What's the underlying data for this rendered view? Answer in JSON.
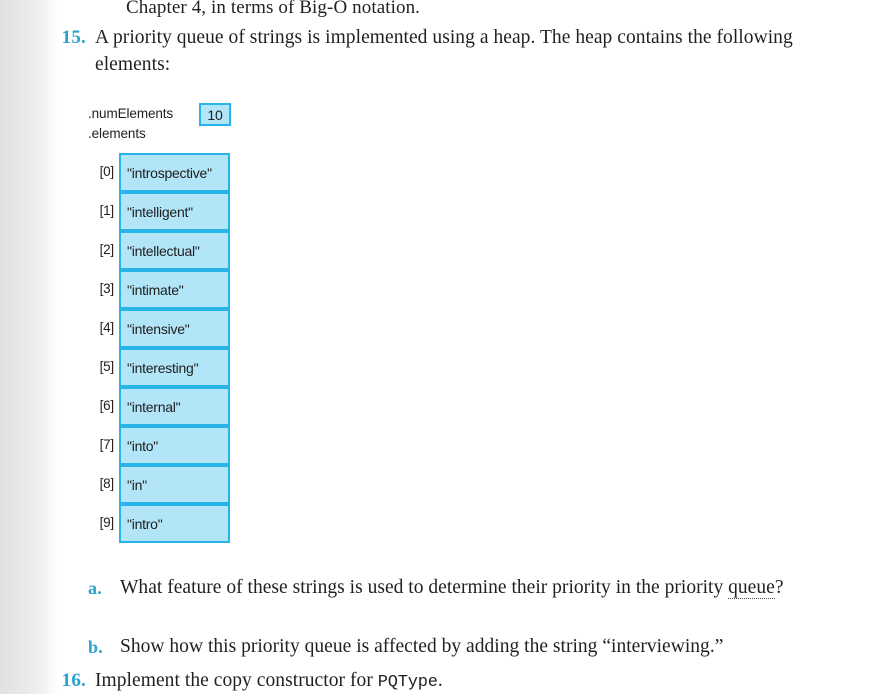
{
  "page": {
    "carryover_line": "Chapter 4, in terms of Big-O notation.",
    "accent_color": "#2aa3cc",
    "box_fill_color": "#b2e5f8",
    "box_border_color": "#28b4e8",
    "text_color": "#231f20"
  },
  "exercise_15": {
    "number": "15.",
    "prompt": "A priority queue of strings is implemented using a heap. The heap contains the following elements:",
    "diagram": {
      "num_elements_label": ".numElements",
      "num_elements_value": "10",
      "elements_label": ".elements",
      "cells": [
        {
          "index": "[0]",
          "value": "\"introspective\""
        },
        {
          "index": "[1]",
          "value": "\"intelligent\""
        },
        {
          "index": "[2]",
          "value": "\"intellectual\""
        },
        {
          "index": "[3]",
          "value": "\"intimate\""
        },
        {
          "index": "[4]",
          "value": "\"intensive\""
        },
        {
          "index": "[5]",
          "value": "\"interesting\""
        },
        {
          "index": "[6]",
          "value": "\"internal\""
        },
        {
          "index": "[7]",
          "value": "\"into\""
        },
        {
          "index": "[8]",
          "value": "\"in\""
        },
        {
          "index": "[9]",
          "value": "\"intro\""
        }
      ]
    },
    "subitems": [
      {
        "letter": "a.",
        "text_before": "What feature of these strings is used to determine their priority in the priority ",
        "flagged_word": "queue",
        "text_after": "?"
      },
      {
        "letter": "b.",
        "text": "Show how this priority queue is affected by adding the string “interviewing.”"
      }
    ]
  },
  "exercise_16": {
    "number": "16.",
    "text_before": "Implement the copy constructor for ",
    "code": "PQType",
    "text_after": "."
  }
}
